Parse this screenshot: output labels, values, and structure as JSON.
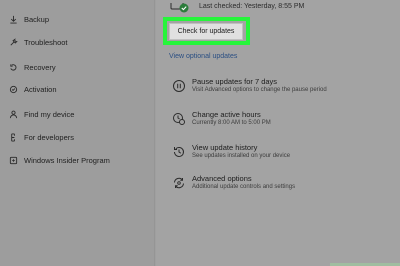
{
  "nav": {
    "items": [
      {
        "label": "Backup",
        "icon": "backup-icon"
      },
      {
        "label": "Troubleshoot",
        "icon": "wrench-icon"
      },
      {
        "label": "Recovery",
        "icon": "recovery-icon"
      },
      {
        "label": "Activation",
        "icon": "activation-icon"
      },
      {
        "label": "Find my device",
        "icon": "person-icon"
      },
      {
        "label": "For developers",
        "icon": "developer-icon"
      },
      {
        "label": "Windows Insider Program",
        "icon": "insider-icon"
      }
    ]
  },
  "main": {
    "last_checked": "Last checked: Yesterday, 8:55 PM",
    "check_button": "Check for updates",
    "highlight_color": "#26f53b",
    "optional_link": "View optional updates",
    "options": [
      {
        "title": "Pause updates for 7 days",
        "subtitle": "Visit Advanced options to change the pause period",
        "icon": "pause-icon"
      },
      {
        "title": "Change active hours",
        "subtitle": "Currently 8:00 AM to 5:00 PM",
        "icon": "clock-icon"
      },
      {
        "title": "View update history",
        "subtitle": "See updates installed on your device",
        "icon": "history-icon"
      },
      {
        "title": "Advanced options",
        "subtitle": "Additional update controls and settings",
        "icon": "settings-sync-icon"
      }
    ]
  }
}
